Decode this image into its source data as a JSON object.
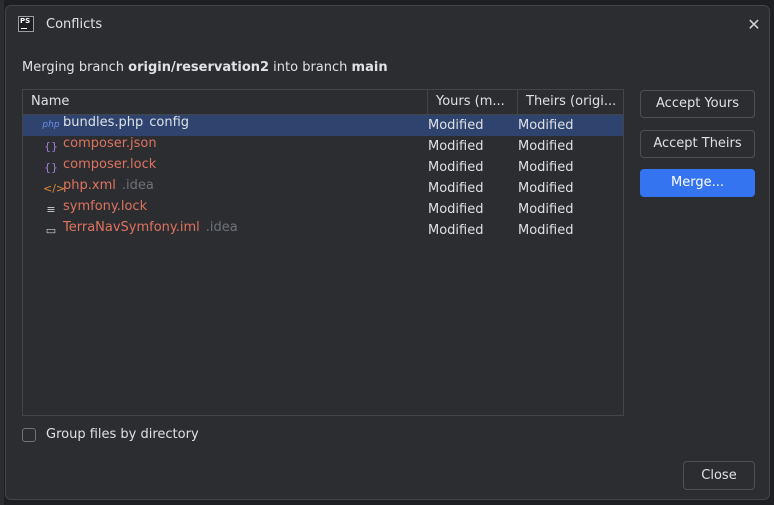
{
  "dialog": {
    "title": "Conflicts",
    "app_icon_text": "PS",
    "close_glyph": "✕"
  },
  "description": {
    "prefix": "Merging branch ",
    "source_branch": "origin/reservation2",
    "middle": " into branch ",
    "target_branch": "main"
  },
  "table": {
    "columns": [
      "Name",
      "Yours (m...",
      "Theirs (origi..."
    ],
    "rows": [
      {
        "icon": "php-icon",
        "glyph": "php",
        "name": "bundles.php",
        "hint": "config",
        "yours": "Modified",
        "theirs": "Modified",
        "selected": true,
        "color": "#dfe1e5"
      },
      {
        "icon": "json-braces-icon",
        "glyph": "{}",
        "name": "composer.json",
        "hint": "",
        "yours": "Modified",
        "theirs": "Modified",
        "selected": false,
        "color": "#e0735f"
      },
      {
        "icon": "json-braces-icon",
        "glyph": "{}",
        "name": "composer.lock",
        "hint": "",
        "yours": "Modified",
        "theirs": "Modified",
        "selected": false,
        "color": "#e0735f"
      },
      {
        "icon": "xml-icon",
        "glyph": "</>",
        "name": "php.xml",
        "hint": ".idea",
        "yours": "Modified",
        "theirs": "Modified",
        "selected": false,
        "color": "#e0735f"
      },
      {
        "icon": "text-lines-icon",
        "glyph": "≡",
        "name": "symfony.lock",
        "hint": "",
        "yours": "Modified",
        "theirs": "Modified",
        "selected": false,
        "color": "#e0735f"
      },
      {
        "icon": "iml-module-icon",
        "glyph": "▭",
        "name": "TerraNavSymfony.iml",
        "hint": ".idea",
        "yours": "Modified",
        "theirs": "Modified",
        "selected": false,
        "color": "#e0735f"
      }
    ]
  },
  "buttons": {
    "accept_yours": "Accept Yours",
    "accept_theirs": "Accept Theirs",
    "merge": "Merge...",
    "close": "Close"
  },
  "options": {
    "group_by_directory_label": "Group files by directory",
    "group_by_directory_checked": false
  },
  "colors": {
    "accent": "#3574f0",
    "selection": "#2e436e",
    "conflict_text": "#e0735f",
    "php_icon": "#6e8ee6",
    "json_icon": "#a77de0",
    "xml_icon": "#e08a3c"
  }
}
